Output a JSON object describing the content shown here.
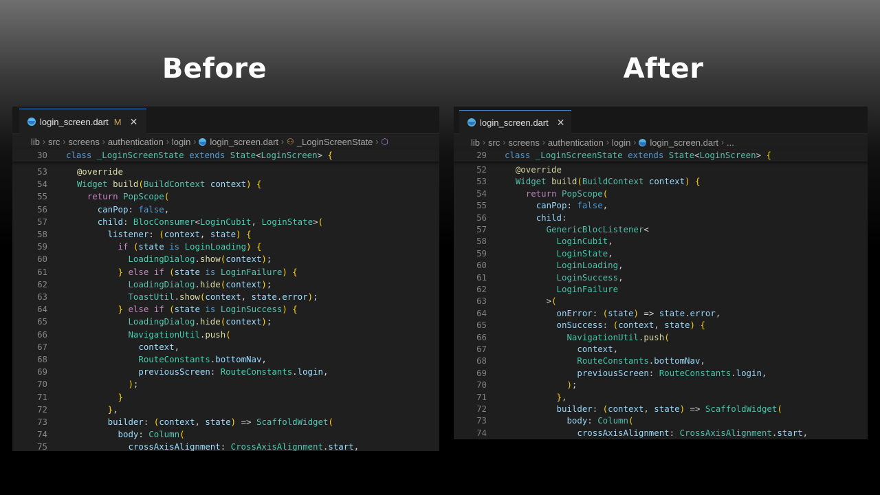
{
  "headings": {
    "before": "Before",
    "after": "After"
  },
  "before": {
    "tab": {
      "filename": "login_screen.dart",
      "modified": "M"
    },
    "breadcrumb": [
      "lib",
      "src",
      "screens",
      "authentication",
      "login",
      "login_screen.dart",
      "_LoginScreenState"
    ],
    "sticky": {
      "line": "30",
      "code": "class _LoginScreenState extends State<LoginScreen> {"
    },
    "lines": [
      {
        "n": "53",
        "code": "    @override"
      },
      {
        "n": "54",
        "code": "    Widget build(BuildContext context) {"
      },
      {
        "n": "55",
        "code": "      return PopScope("
      },
      {
        "n": "56",
        "code": "        canPop: false,"
      },
      {
        "n": "57",
        "code": "        child: BlocConsumer<LoginCubit, LoginState>("
      },
      {
        "n": "58",
        "code": "          listener: (context, state) {"
      },
      {
        "n": "59",
        "code": "            if (state is LoginLoading) {"
      },
      {
        "n": "60",
        "code": "              LoadingDialog.show(context);"
      },
      {
        "n": "61",
        "code": "            } else if (state is LoginFailure) {"
      },
      {
        "n": "62",
        "code": "              LoadingDialog.hide(context);"
      },
      {
        "n": "63",
        "code": "              ToastUtil.show(context, state.error);"
      },
      {
        "n": "64",
        "code": "            } else if (state is LoginSuccess) {"
      },
      {
        "n": "65",
        "code": "              LoadingDialog.hide(context);"
      },
      {
        "n": "66",
        "code": "              NavigationUtil.push("
      },
      {
        "n": "67",
        "code": "                context,"
      },
      {
        "n": "68",
        "code": "                RouteConstants.bottomNav,"
      },
      {
        "n": "69",
        "code": "                previousScreen: RouteConstants.login,"
      },
      {
        "n": "70",
        "code": "              );"
      },
      {
        "n": "71",
        "code": "            }"
      },
      {
        "n": "72",
        "code": "          },"
      },
      {
        "n": "73",
        "code": "          builder: (context, state) => ScaffoldWidget("
      },
      {
        "n": "74",
        "code": "            body: Column("
      },
      {
        "n": "75",
        "code": "              crossAxisAlignment: CrossAxisAlignment.start,"
      }
    ]
  },
  "after": {
    "tab": {
      "filename": "login_screen.dart"
    },
    "breadcrumb": [
      "lib",
      "src",
      "screens",
      "authentication",
      "login",
      "login_screen.dart",
      "..."
    ],
    "sticky": {
      "line": "29",
      "code": "class _LoginScreenState extends State<LoginScreen> {"
    },
    "lines": [
      {
        "n": "52",
        "code": "    @override"
      },
      {
        "n": "53",
        "code": "    Widget build(BuildContext context) {"
      },
      {
        "n": "54",
        "code": "      return PopScope("
      },
      {
        "n": "55",
        "code": "        canPop: false,"
      },
      {
        "n": "56",
        "code": "        child:"
      },
      {
        "n": "57",
        "code": "          GenericBlocListener<"
      },
      {
        "n": "58",
        "code": "            LoginCubit,"
      },
      {
        "n": "59",
        "code": "            LoginState,"
      },
      {
        "n": "60",
        "code": "            LoginLoading,"
      },
      {
        "n": "61",
        "code": "            LoginSuccess,"
      },
      {
        "n": "62",
        "code": "            LoginFailure"
      },
      {
        "n": "63",
        "code": "          >("
      },
      {
        "n": "64",
        "code": "            onError: (state) => state.error,"
      },
      {
        "n": "65",
        "code": "            onSuccess: (context, state) {"
      },
      {
        "n": "66",
        "code": "              NavigationUtil.push("
      },
      {
        "n": "67",
        "code": "                context,"
      },
      {
        "n": "68",
        "code": "                RouteConstants.bottomNav,"
      },
      {
        "n": "69",
        "code": "                previousScreen: RouteConstants.login,"
      },
      {
        "n": "70",
        "code": "              );"
      },
      {
        "n": "71",
        "code": "            },"
      },
      {
        "n": "72",
        "code": "            builder: (context, state) => ScaffoldWidget("
      },
      {
        "n": "73",
        "code": "              body: Column("
      },
      {
        "n": "74",
        "code": "                crossAxisAlignment: CrossAxisAlignment.start,"
      }
    ]
  }
}
